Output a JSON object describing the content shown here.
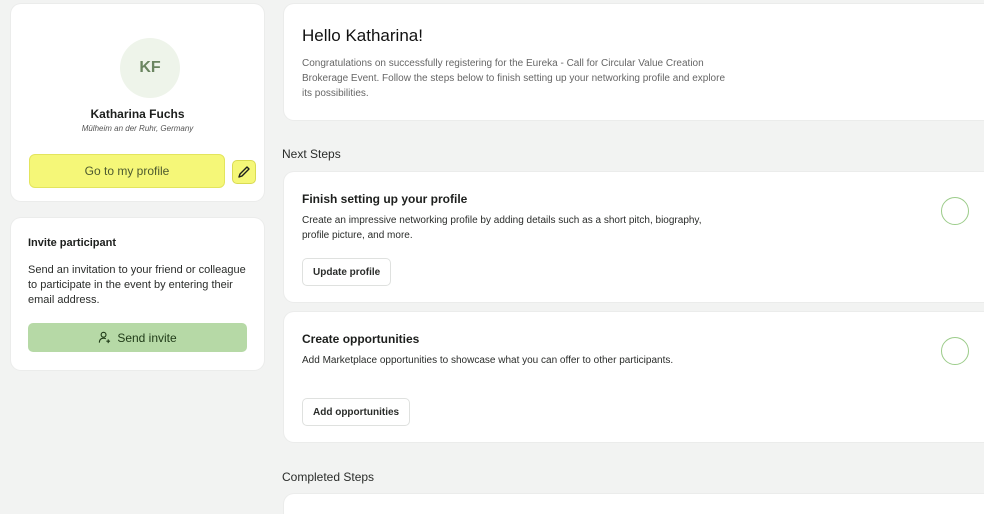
{
  "profile": {
    "initials": "KF",
    "name": "Katharina Fuchs",
    "location": "Mülheim an der Ruhr, Germany",
    "go_profile_label": "Go to my profile"
  },
  "invite": {
    "title": "Invite participant",
    "description": "Send an invitation to your friend or colleague to participate in the event by entering their email address.",
    "button_label": "Send invite"
  },
  "welcome": {
    "title": "Hello Katharina!",
    "description": "Congratulations on successfully registering for the Eureka - Call for Circular Value Creation Brokerage Event. Follow the steps below to finish setting up your networking profile and explore its possibilities."
  },
  "next_steps": {
    "label": "Next Steps",
    "items": [
      {
        "title": "Finish setting up your profile",
        "description": "Create an impressive networking profile by adding details such as a short pitch, biography, profile picture, and more.",
        "button_label": "Update profile"
      },
      {
        "title": "Create opportunities",
        "description": "Add Marketplace opportunities to showcase what you can offer to other participants.",
        "button_label": "Add opportunities"
      }
    ]
  },
  "completed_steps": {
    "label": "Completed Steps"
  },
  "colors": {
    "highlight": "#f5f778",
    "invite_button": "#b6d9a6",
    "step_circle": "#9ccc8a"
  }
}
